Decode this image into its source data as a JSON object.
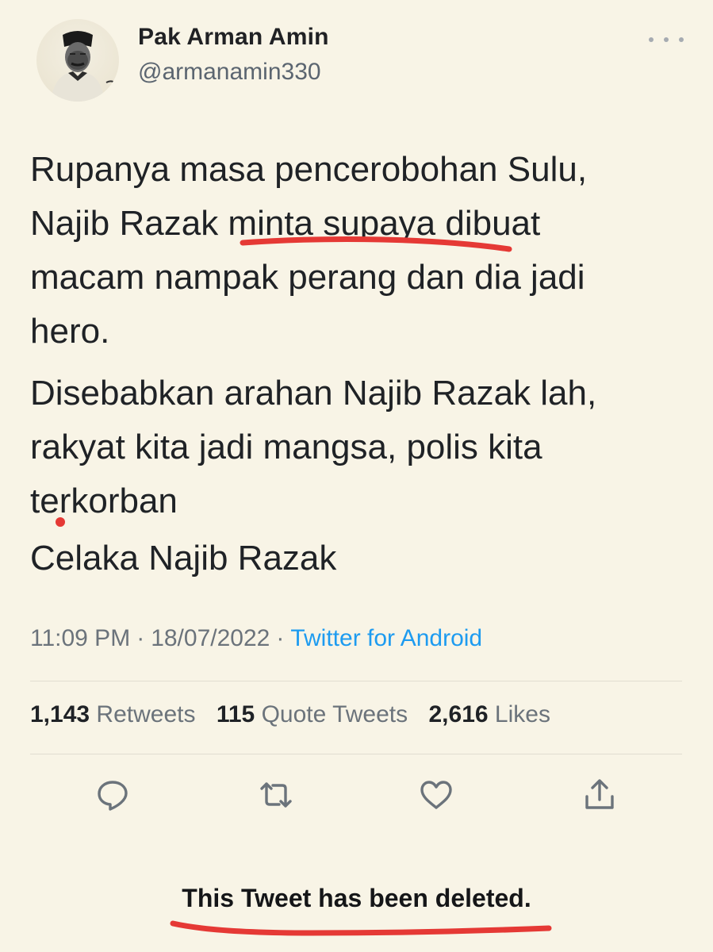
{
  "user": {
    "display_name": "Pak Arman Amin",
    "handle": "@armanamin330",
    "avatar": "profile-photo"
  },
  "more_icon": "more-horizontal-icon",
  "tweet": {
    "lines_para1": [
      "Rupanya masa pencerobohan  Sulu,",
      "Najib Razak minta supaya dibuat",
      "macam nampak perang dan dia jadi",
      "hero."
    ],
    "lines_para2": [
      "Disebabkan arahan Najib Razak lah,",
      "rakyat kita jadi mangsa, polis kita",
      "terkorban"
    ],
    "para3": "Celaka Najib Razak"
  },
  "meta": {
    "time": "11:09 PM",
    "separator": "·",
    "date": "18/07/2022",
    "source": "Twitter for Android"
  },
  "stats": {
    "retweets_count": "1,143",
    "retweets_label": "Retweets",
    "quotes_count": "115",
    "quotes_label": "Quote Tweets",
    "likes_count": "2,616",
    "likes_label": "Likes"
  },
  "actions": [
    "reply-icon",
    "retweet-icon",
    "like-icon",
    "share-icon"
  ],
  "deleted_notice": "This Tweet has been deleted.",
  "colors": {
    "background": "#f8f4e6",
    "link": "#1d9bf0",
    "annotation": "#e53935",
    "muted": "#6b737b"
  }
}
